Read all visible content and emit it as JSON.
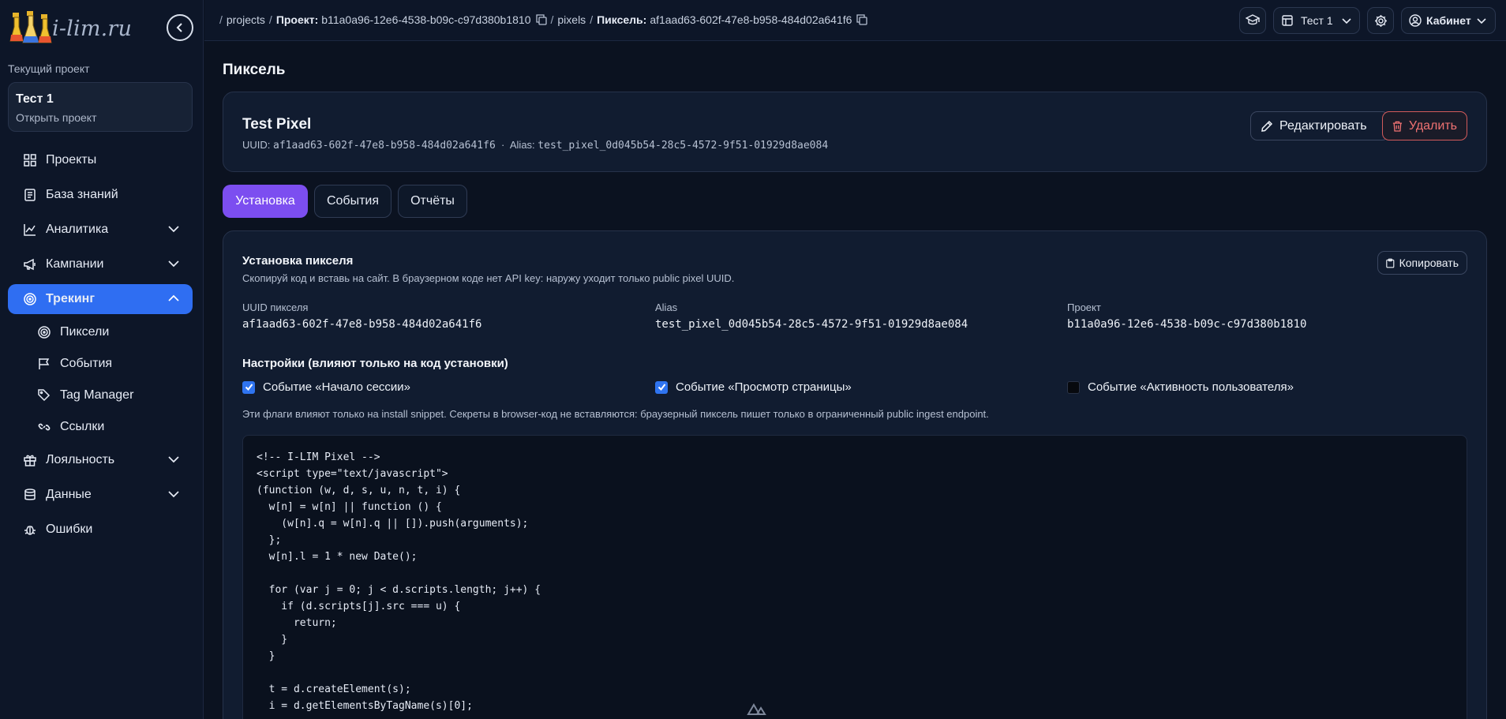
{
  "brand": {
    "logo_text": "i-lim.ru"
  },
  "sidebar": {
    "current_project_label": "Текущий проект",
    "project_name": "Тест 1",
    "project_open": "Открыть проект",
    "items": [
      {
        "label": "Проекты",
        "icon": "grid-icon"
      },
      {
        "label": "База знаний",
        "icon": "document-icon"
      },
      {
        "label": "Аналитика",
        "icon": "chart-line-icon"
      },
      {
        "label": "Кампании",
        "icon": "megaphone-icon"
      },
      {
        "label": "Трекинг",
        "icon": "target-icon"
      },
      {
        "label": "Лояльность",
        "icon": "gift-icon"
      },
      {
        "label": "Данные",
        "icon": "database-icon"
      },
      {
        "label": "Ошибки",
        "icon": "bug-icon"
      }
    ],
    "tracking_sub": [
      {
        "label": "Пиксели",
        "icon": "target-icon"
      },
      {
        "label": "События",
        "icon": "flag-icon"
      },
      {
        "label": "Tag Manager",
        "icon": "tags-icon"
      },
      {
        "label": "Ссылки",
        "icon": "link-icon"
      }
    ]
  },
  "topbar": {
    "crumb_projects": "projects",
    "crumb_project_label": "Проект:",
    "crumb_project_id": "b11a0a96-12e6-4538-b09c-c97d380b1810",
    "crumb_pixels": "pixels",
    "crumb_pixel_label": "Пиксель:",
    "crumb_pixel_id": "af1aad63-602f-47e8-b958-484d02a641f6",
    "project_select": "Тест 1",
    "cabinet": "Кабинет"
  },
  "page": {
    "title": "Пиксель",
    "pixel_name": "Test Pixel",
    "uuid_label": "UUID:",
    "uuid": "af1aad63-602f-47e8-b958-484d02a641f6",
    "alias_label": "Alias:",
    "alias": "test_pixel_0d045b54-28c5-4572-9f51-01929d8ae084",
    "edit_button": "Редактировать",
    "delete_button": "Удалить",
    "tabs": [
      "Установка",
      "События",
      "Отчёты"
    ]
  },
  "install": {
    "title": "Установка пикселя",
    "description": "Скопируй код и вставь на сайт. В браузерном коде нет API key: наружу уходит только public pixel UUID.",
    "copy_button": "Копировать",
    "fields": [
      {
        "label": "UUID пикселя",
        "value": "af1aad63-602f-47e8-b958-484d02a641f6"
      },
      {
        "label": "Alias",
        "value": "test_pixel_0d045b54-28c5-4572-9f51-01929d8ae084"
      },
      {
        "label": "Проект",
        "value": "b11a0a96-12e6-4538-b09c-c97d380b1810"
      }
    ],
    "settings_title": "Настройки (влияют только на код установки)",
    "checkboxes": [
      {
        "label": "Событие «Начало сессии»",
        "checked": true
      },
      {
        "label": "Событие «Просмотр страницы»",
        "checked": true
      },
      {
        "label": "Событие «Активность пользователя»",
        "checked": false
      }
    ],
    "flags_note": "Эти флаги влияют только на install snippet. Секреты в browser-код не вставляются: браузерный пиксель пишет только в ограниченный public ingest endpoint.",
    "code": "<!-- I-LIM Pixel -->\n<script type=\"text/javascript\">\n(function (w, d, s, u, n, t, i) {\n  w[n] = w[n] || function () {\n    (w[n].q = w[n].q || []).push(arguments);\n  };\n  w[n].l = 1 * new Date();\n\n  for (var j = 0; j < d.scripts.length; j++) {\n    if (d.scripts[j].src === u) {\n      return;\n    }\n  }\n\n  t = d.createElement(s);\n  i = d.getElementsByTagName(s)[0];"
  },
  "colors": {
    "accent": "#2f6ef2",
    "tab_active": "#7c4ef0",
    "danger": "#f07272"
  }
}
